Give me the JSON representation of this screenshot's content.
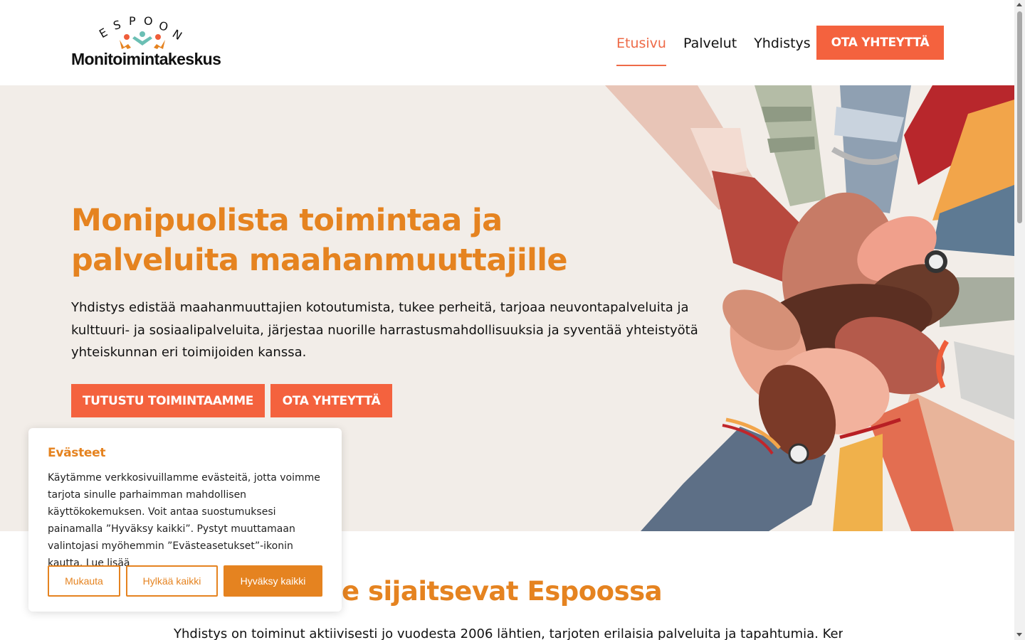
{
  "header": {
    "logo_top": "ESPOON",
    "logo_word": "Monitoimintakeskus",
    "nav": [
      "Etusivu",
      "Palvelut",
      "Yhdistys"
    ],
    "nav_active": "Etusivu",
    "cta": "OTA YHTEYTTÄ"
  },
  "hero": {
    "title": "Monipuolista toimintaa ja palveluita maahanmuuttajille",
    "text": "Yhdistys edistää maahanmuuttajien kotoutumista, tukee perheitä, tarjoaa neuvontapalveluita ja kulttuuri- ja sosiaalipalveluita, järjestaa nuorille harrastusmahdollisuuksia ja syventää yhteistyötä yhteiskunnan eri toimijoiden kanssa.",
    "button_primary": "TUTUSTU TOIMINTAAMME",
    "button_secondary": "OTA YHTEYTTÄ",
    "image": "hands-together-illustration"
  },
  "section": {
    "title_visible": "e sijaitsevat Espoossa",
    "text_visible": "Yhdistys on toiminut aktiivisesti jo vuodesta 2006 lähtien, tarjoten erilaisia palveluita ja tapahtumia. Kerhotila"
  },
  "cookie": {
    "title": "Evästeet",
    "text": "Käytämme verkkosivuillamme evästeitä, jotta voimme tarjota sinulle parhaimman mahdollisen käyttökokemuksen. Voit antaa suostumuksesi painamalla ”Hyväksy kaikki”. Pystyt muuttamaan valintojasi myöhemmin ”Evästeasetukset”-ikonin kautta. Lue lisää",
    "btn_customize": "Mukauta",
    "btn_reject": "Hylkää kaikki",
    "btn_accept": "Hyväksy kaikki"
  },
  "colors": {
    "accent": "#f4623e",
    "brand_orange": "#e58320",
    "hero_bg": "#f2ede8"
  }
}
